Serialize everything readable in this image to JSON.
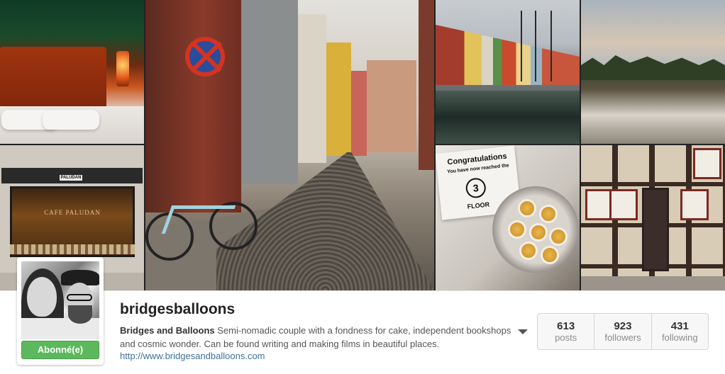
{
  "collage": {
    "cafe_sign": "PALUDAN",
    "cafe_name": "CAFE PALUDAN",
    "card_title": "Congratulations",
    "card_subtitle": "You have now reached the",
    "card_floor_number": "3",
    "card_floor_word": "FLOOR"
  },
  "profile": {
    "username": "bridgesballoons",
    "bio_name": "Bridges and Balloons",
    "bio_text": "Semi-nomadic couple with a fondness for cake, independent bookshops and cosmic wonder. Can be found writing and making films in beautiful places.",
    "link": "http://www.bridgesandballoons.com",
    "follow_label": "Abonné(e)"
  },
  "stats": [
    {
      "value": "613",
      "label": "posts"
    },
    {
      "value": "923",
      "label": "followers"
    },
    {
      "value": "431",
      "label": "following"
    }
  ],
  "colors": {
    "follow_button": "#5cb85c",
    "link": "#3f729b"
  }
}
